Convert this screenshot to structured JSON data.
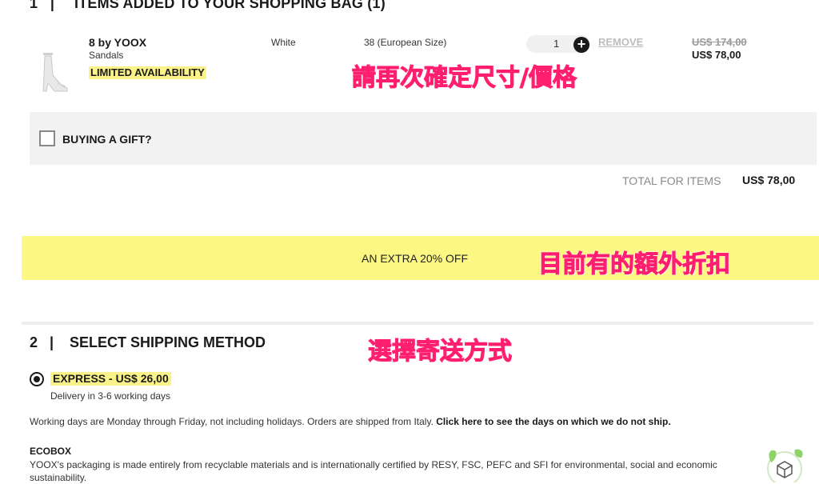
{
  "bag": {
    "section_number": "1",
    "separator": "|",
    "title": "ITEMS ADDED TO YOUR SHOPPING BAG (1)",
    "item": {
      "brand": "8 by YOOX",
      "type": "Sandals",
      "availability": "LIMITED AVAILABILITY",
      "color": "White",
      "size": "38 (European Size)",
      "quantity": "1",
      "plus_label": "+",
      "remove_label": "REMOVE",
      "old_price": "US$ 174,00",
      "price": "US$ 78,00"
    },
    "gift_label": "BUYING A GIFT?",
    "total_label": "TOTAL FOR ITEMS",
    "total_value": "US$ 78,00"
  },
  "promo": {
    "text": "AN EXTRA 20% OFF"
  },
  "annotations": {
    "note1": "請再次確定尺寸/價格",
    "note2": "目前有的額外折扣",
    "note3": "選擇寄送方式"
  },
  "shipping": {
    "section_number": "2",
    "separator": "|",
    "title": "SELECT SHIPPING METHOD",
    "option_label": "EXPRESS - US$ 26,00",
    "option_delivery": "Delivery in 3-6 working days",
    "working_days_text": "Working days are Monday through Friday, not including holidays. Orders are shipped from Italy.",
    "working_days_link": "Click here to see the days on which we do not ship.",
    "ecobox_title": "ECOBOX",
    "ecobox_text": "YOOX's packaging is made entirely from recyclable materials and is internationally certified by RESY, FSC, PEFC and SFI for environmental, social and economic sustainability."
  },
  "icons": {
    "product": "sandal-product-image",
    "plus": "plus-icon",
    "checkbox": "checkbox-icon",
    "radio": "radio-selected-icon",
    "ecobox": "eco-box-icon"
  },
  "colors": {
    "highlight": "#fbf38a",
    "promo_bar": "#fcf883",
    "annotation": "#ff1f6e",
    "gift_bar": "#f2f2f2"
  }
}
